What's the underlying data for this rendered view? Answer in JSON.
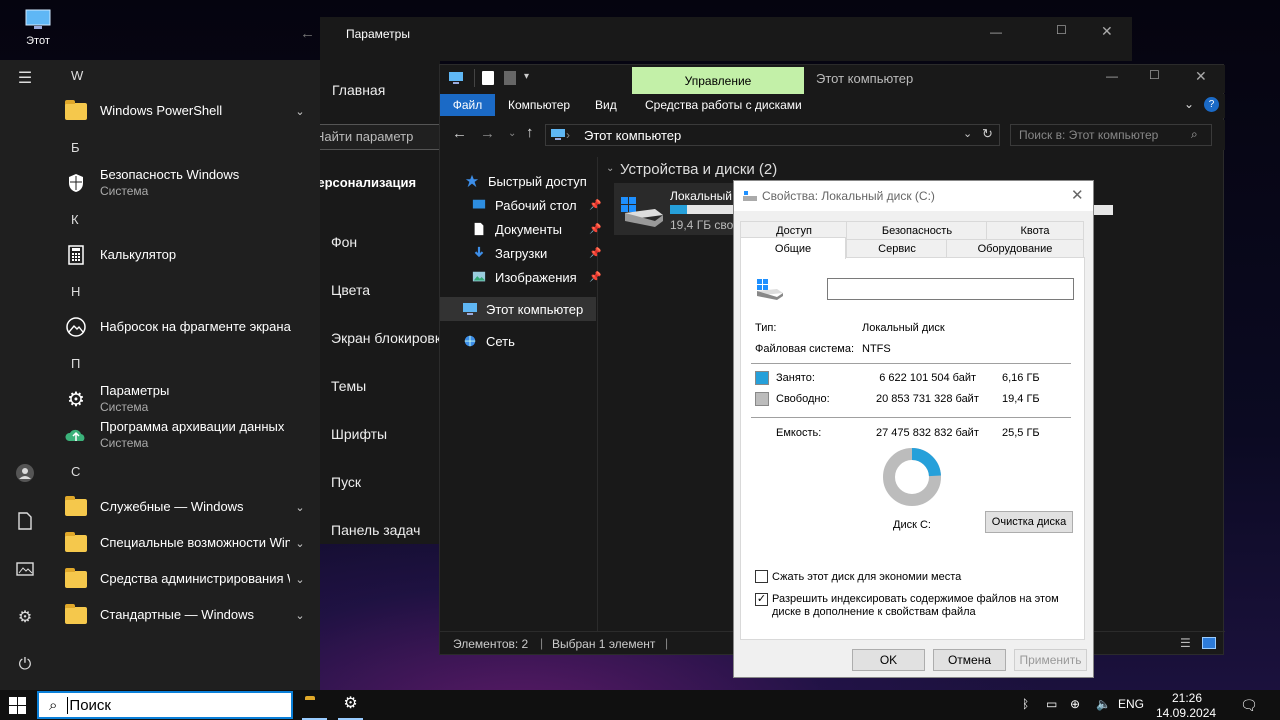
{
  "desktop": {
    "icon_label": "Этот"
  },
  "start_menu": {
    "groups": [
      {
        "letter": "W",
        "apps": [
          {
            "name": "Windows PowerShell",
            "sub": "",
            "icon": "folder-icon",
            "expand": true
          }
        ]
      },
      {
        "letter": "Б",
        "apps": [
          {
            "name": "Безопасность Windows",
            "sub": "Система",
            "icon": "shield-icon",
            "expand": false
          }
        ]
      },
      {
        "letter": "К",
        "apps": [
          {
            "name": "Калькулятор",
            "sub": "",
            "icon": "calculator-icon",
            "expand": false
          }
        ]
      },
      {
        "letter": "Н",
        "apps": [
          {
            "name": "Набросок на фрагменте экрана",
            "sub": "",
            "icon": "snip-icon",
            "expand": false
          }
        ]
      },
      {
        "letter": "П",
        "apps": [
          {
            "name": "Параметры",
            "sub": "Система",
            "icon": "gear-icon",
            "expand": false
          },
          {
            "name": "Программа архивации данных",
            "sub": "Система",
            "icon": "backup-icon",
            "expand": false
          }
        ]
      },
      {
        "letter": "С",
        "apps": [
          {
            "name": "Служебные — Windows",
            "sub": "",
            "icon": "folder-icon",
            "expand": true
          },
          {
            "name": "Специальные возможности Win...",
            "sub": "",
            "icon": "folder-icon",
            "expand": true
          },
          {
            "name": "Средства администрирования W...",
            "sub": "",
            "icon": "folder-icon",
            "expand": true
          },
          {
            "name": "Стандартные — Windows",
            "sub": "",
            "icon": "folder-icon",
            "expand": true
          }
        ]
      }
    ]
  },
  "settings": {
    "title": "Параметры",
    "home": "Главная",
    "search_placeholder": "Найти параметр",
    "section": "Персонализация",
    "items": [
      "Фон",
      "Цвета",
      "Экран блокировки",
      "Темы",
      "Шрифты",
      "Пуск",
      "Панель задач"
    ]
  },
  "explorer": {
    "title": "Этот компьютер",
    "contextual_tab": "Управление",
    "ribbon_tabs": [
      "Файл",
      "Компьютер",
      "Вид",
      "Средства работы с дисками"
    ],
    "address": "Этот компьютер",
    "search_placeholder": "Поиск в: Этот компьютер",
    "nav": {
      "quick_access": "Быстрый доступ",
      "items": [
        "Рабочий стол",
        "Документы",
        "Загрузки",
        "Изображения"
      ],
      "this_pc": "Этот компьютер",
      "network": "Сеть"
    },
    "group_title": "Устройства и диски (2)",
    "drive": {
      "name": "Локальный",
      "free": "19,4 ГБ сво",
      "usage": 0.24
    },
    "status": {
      "items": "Элементов: 2",
      "selected": "Выбран 1 элемент"
    }
  },
  "dialog": {
    "title": "Свойства: Локальный диск (C:)",
    "tabs_top": [
      "Доступ",
      "Безопасность",
      "Квота"
    ],
    "tabs_bottom": [
      "Общие",
      "Сервис",
      "Оборудование"
    ],
    "name_value": "",
    "type_label": "Тип:",
    "type_value": "Локальный диск",
    "fs_label": "Файловая система:",
    "fs_value": "NTFS",
    "used": {
      "label": "Занято:",
      "bytes": "6 622 101 504 байт",
      "size": "6,16 ГБ"
    },
    "free": {
      "label": "Свободно:",
      "bytes": "20 853 731 328 байт",
      "size": "19,4 ГБ"
    },
    "capacity": {
      "label": "Емкость:",
      "bytes": "27 475 832 832 байт",
      "size": "25,5 ГБ"
    },
    "used_fraction": 0.241,
    "disk_label": "Диск C:",
    "cleanup": "Очистка диска",
    "compress": "Сжать этот диск для экономии места",
    "compress_checked": false,
    "index": "Разрешить индексировать содержимое файлов на этом диске в дополнение к свойствам файла",
    "index_checked": true,
    "ok": "OK",
    "cancel": "Отмена",
    "apply": "Применить",
    "colors": {
      "used": "#26a0da",
      "free": "#bcbcbc"
    }
  },
  "taskbar": {
    "search_placeholder": "Поиск",
    "lang": "ENG",
    "time": "21:26",
    "date": "14.09.2024"
  }
}
